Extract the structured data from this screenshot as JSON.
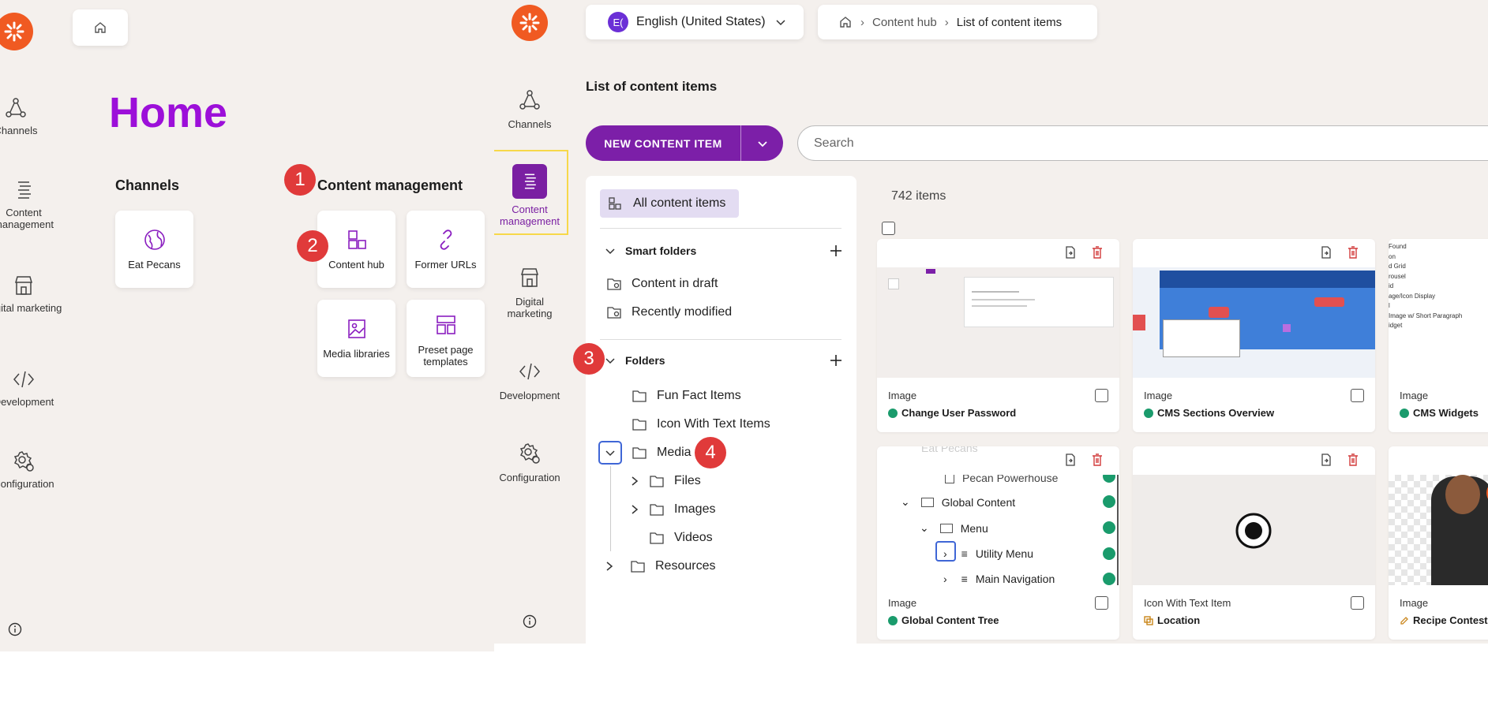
{
  "left_panel": {
    "title": "Home",
    "nav": [
      {
        "label": "Channels",
        "icon": "channels-icon"
      },
      {
        "label": "Content management",
        "icon": "content-management-icon"
      },
      {
        "label": "Digital marketing",
        "icon": "store-icon"
      },
      {
        "label": "Development",
        "icon": "code-icon"
      },
      {
        "label": "Configuration",
        "icon": "gear-icon"
      }
    ],
    "channels_heading": "Channels",
    "channels_card": "Eat Pecans",
    "content_mgmt_heading": "Content management",
    "cards": [
      "Content hub",
      "Former URLs",
      "Media libraries",
      "Preset page templates"
    ],
    "badges": [
      "1",
      "2",
      "3",
      "4"
    ]
  },
  "right_panel": {
    "language": {
      "code": "E(",
      "label": "English (United States)"
    },
    "breadcrumb": {
      "item1": "Content hub",
      "item2": "List of content items"
    },
    "nav": [
      {
        "label": "Channels"
      },
      {
        "label": "Content management"
      },
      {
        "label": "Digital marketing"
      },
      {
        "label": "Development"
      },
      {
        "label": "Configuration"
      }
    ],
    "page_title": "List of content items",
    "new_button": "NEW CONTENT ITEM",
    "search_placeholder": "Search",
    "all_items": "All content items",
    "smart_folders": {
      "label": "Smart folders",
      "items": [
        "Content in draft",
        "Recently modified"
      ]
    },
    "folders": {
      "label": "Folders",
      "items": [
        "Fun Fact Items",
        "Icon With Text Items",
        "Media",
        "Files",
        "Images",
        "Videos",
        "Resources"
      ]
    },
    "items_count": "742 items",
    "cards": [
      {
        "type": "Image",
        "name": "Change User Password"
      },
      {
        "type": "Image",
        "name": "CMS Sections Overview"
      },
      {
        "type": "Image",
        "name": "CMS Widgets"
      },
      {
        "type": "Image",
        "name": "Global Content Tree"
      },
      {
        "type": "Icon With Text Item",
        "name": "Location"
      },
      {
        "type": "Image",
        "name": "Recipe Contest"
      }
    ],
    "thumb_tree": {
      "rows": [
        "Eat Pecans",
        "Pecan Powerhouse",
        "Global Content",
        "Menu",
        "Utility Menu",
        "Main Navigation"
      ]
    },
    "widget_list": [
      "Found",
      "on",
      "d Grid",
      "rousel",
      "id",
      "age/Icon Display",
      "l",
      "Image w/ Short Paragraph",
      "idget"
    ],
    "colors": {
      "accent": "#7c1fa8",
      "title": "#9c0fd9",
      "logo": "#f05a22",
      "badge": "#e03a3a",
      "published": "#1a9b6c"
    }
  }
}
